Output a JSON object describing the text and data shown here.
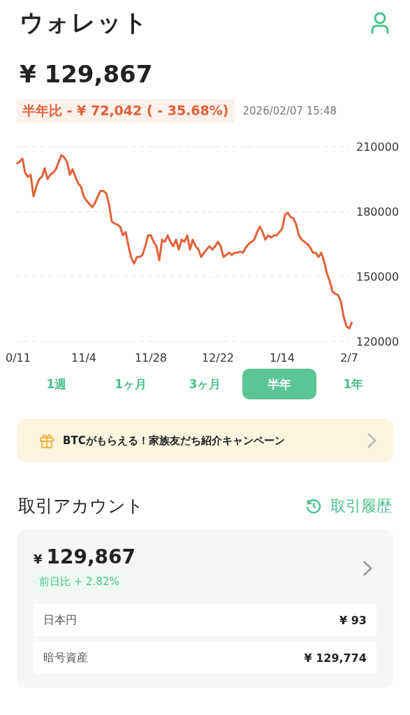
{
  "header": {
    "title": "ウォレット"
  },
  "balance": "¥ 129,867",
  "change": {
    "text": "半年比 - ¥ 72,042 ( - 35.68%)"
  },
  "timestamp": "2026/02/07 15:48",
  "chart": {
    "chart_data": {
      "type": "line",
      "ylim": [
        120000,
        210000
      ],
      "yticks": [
        120000,
        150000,
        180000,
        210000
      ],
      "categories": [
        "0/11",
        null,
        null,
        null,
        null,
        null,
        null,
        null,
        null,
        null,
        null,
        null,
        null,
        null,
        null,
        null,
        null,
        null,
        null,
        null,
        null,
        null,
        null,
        null,
        "11/4",
        null,
        null,
        null,
        null,
        null,
        null,
        null,
        null,
        null,
        null,
        null,
        null,
        null,
        null,
        null,
        null,
        null,
        null,
        null,
        null,
        null,
        null,
        null,
        "11/28",
        null,
        null,
        null,
        null,
        null,
        null,
        null,
        null,
        null,
        null,
        null,
        null,
        null,
        null,
        null,
        null,
        null,
        null,
        null,
        null,
        null,
        null,
        null,
        "12/22",
        null,
        null,
        null,
        null,
        null,
        null,
        null,
        null,
        null,
        null,
        null,
        null,
        null,
        null,
        null,
        null,
        null,
        null,
        null,
        null,
        null,
        null,
        "1/14",
        null,
        null,
        null,
        null,
        null,
        null,
        null,
        null,
        null,
        null,
        null,
        null,
        null,
        null,
        null,
        null,
        null,
        null,
        null,
        null,
        null,
        null,
        null,
        "2/7",
        null
      ],
      "series": [
        {
          "color": "#e0623a",
          "values": [
            202000,
            203000,
            204500,
            198000,
            196000,
            197000,
            187000,
            191500,
            195000,
            196000,
            200000,
            195000,
            197000,
            198000,
            199500,
            203000,
            206000,
            205000,
            203000,
            197000,
            199500,
            196000,
            193000,
            191500,
            187000,
            185000,
            183500,
            182000,
            184000,
            187000,
            189500,
            189500,
            188500,
            183500,
            175500,
            174500,
            174000,
            173000,
            169000,
            170500,
            164000,
            158500,
            156000,
            159000,
            159000,
            160000,
            164000,
            169000,
            169000,
            166000,
            164000,
            157500,
            167000,
            166000,
            169000,
            166000,
            164000,
            167000,
            162500,
            167000,
            166000,
            169000,
            162500,
            167000,
            164000,
            162500,
            159000,
            161000,
            162500,
            164000,
            162500,
            164000,
            166000,
            164000,
            159000,
            160000,
            161000,
            160000,
            161000,
            161000,
            161500,
            161000,
            163500,
            165000,
            166000,
            167000,
            170500,
            173000,
            170500,
            167000,
            169000,
            168000,
            169000,
            169000,
            170500,
            172000,
            178500,
            179500,
            177500,
            177000,
            174000,
            169000,
            167000,
            166000,
            165000,
            163500,
            161000,
            161000,
            159000,
            161000,
            157000,
            151500,
            148000,
            143000,
            142000,
            141500,
            138500,
            131500,
            127000,
            126000,
            129000
          ]
        }
      ]
    }
  },
  "ranges": [
    {
      "label": "1週",
      "selected": false
    },
    {
      "label": "1ヶ月",
      "selected": false
    },
    {
      "label": "3ヶ月",
      "selected": false
    },
    {
      "label": "半年",
      "selected": true
    },
    {
      "label": "1年",
      "selected": false
    }
  ],
  "banner": {
    "text": "BTCがもらえる！家族友だち紹介キャンペーン"
  },
  "account": {
    "title": "取引アカウント",
    "history_link": "取引履歴",
    "currency": "¥",
    "amount": "129,867",
    "change": {
      "text": "前日比 + 2.82%"
    },
    "rows": [
      {
        "label": "日本円",
        "value": "¥ 93"
      },
      {
        "label": "暗号資産",
        "value": "¥ 129,774"
      }
    ]
  }
}
